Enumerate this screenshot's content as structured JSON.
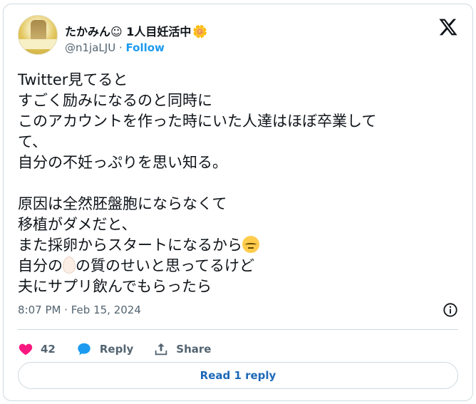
{
  "author": {
    "name": "たかみん☺︎ 1人目妊活中",
    "name_flower": "🌼",
    "handle": "@n1jaLJU",
    "separator": "·",
    "follow_label": "Follow"
  },
  "tweet": {
    "line1": "Twitter見てると",
    "line2": "すごく励みになるのと同時に",
    "line3": "このアカウントを作った時にいた人達はほぼ卒業して",
    "line4": "て、",
    "line5": "自分の不妊っぷりを思い知る。",
    "line6": "原因は全然胚盤胞にならなくて",
    "line7": "移植がダメだと、",
    "line8": "また採卵からスタートになるから",
    "line9_a": "自分の",
    "line9_b": "の質のせいと思ってるけど",
    "line10": "夫にサプリ飲んでもらったら",
    "timestamp": "8:07 PM · Feb 15, 2024"
  },
  "actions": {
    "like_count": "42",
    "reply_label": "Reply",
    "share_label": "Share",
    "read_reply_label": "Read 1 reply"
  },
  "icons": {
    "like": "heart-icon",
    "reply": "speech-bubble-icon",
    "share": "share-upload-icon",
    "info": "info-icon",
    "logo": "x-logo-icon"
  },
  "colors": {
    "like": "#f91880",
    "reply": "#1d9bf0",
    "link": "#1d9bf0",
    "muted": "#536471"
  }
}
